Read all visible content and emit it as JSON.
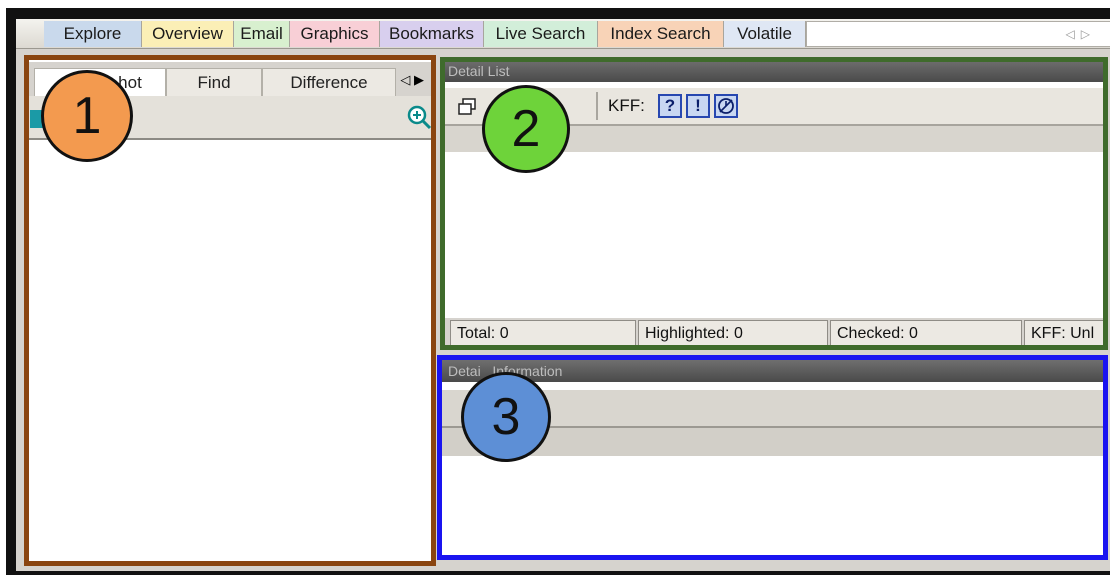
{
  "top_tabs": {
    "explore": "Explore",
    "overview": "Overview",
    "email": "Email",
    "graphics": "Graphics",
    "bookmarks": "Bookmarks",
    "live_search": "Live Search",
    "index_search": "Index Search",
    "volatile": "Volatile"
  },
  "left_panel": {
    "tabs": {
      "snapshot": "hot",
      "find": "Find",
      "difference": "Difference"
    }
  },
  "detail_list": {
    "title": "Detail List",
    "kff_label": "KFF:",
    "kff_buttons": [
      "?",
      "!"
    ]
  },
  "status_bar": {
    "total": "Total: 0",
    "highlighted": "Highlighted: 0",
    "checked": "Checked: 0",
    "kff": "KFF: Unl"
  },
  "detail_info": {
    "title": "Detai   Information"
  },
  "markers": {
    "one": "1",
    "two": "2",
    "three": "3"
  },
  "colors": {
    "box_1": "#8a4510",
    "box_2": "#3f6b2c",
    "box_3": "#1a14f0",
    "marker_1": "#f39a4f",
    "marker_2": "#6ed33a",
    "marker_3": "#5d8fd6"
  }
}
